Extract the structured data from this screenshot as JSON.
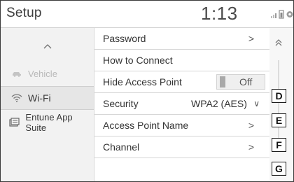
{
  "header": {
    "title": "Setup",
    "clock": "1:13"
  },
  "sidebar": {
    "scroll_up_icon": "chevron-up-icon",
    "items": [
      {
        "label": "Vehicle",
        "icon": "car-icon",
        "state": "dim"
      },
      {
        "label": "Wi-Fi",
        "icon": "wifi-icon",
        "state": "selected"
      },
      {
        "label": "Entune App Suite",
        "icon": "app-suite-icon",
        "state": "normal"
      }
    ]
  },
  "list": {
    "rows": [
      {
        "label": "Password",
        "chevron": ">"
      },
      {
        "label": "How to Connect"
      },
      {
        "label": "Hide Access Point",
        "toggle_value": "Off"
      },
      {
        "label": "Security",
        "value": "WPA2 (AES)",
        "value_chevron": "∨"
      },
      {
        "label": "Access Point Name",
        "chevron": ">"
      },
      {
        "label": "Channel",
        "chevron": ">"
      }
    ]
  },
  "scrollbar": {
    "up_icon": "double-chevron-up-icon"
  },
  "callouts": [
    "D",
    "E",
    "F",
    "G"
  ],
  "colors": {
    "background": "#f7f7f7",
    "list_background": "#ffffff",
    "selected_item": "#e6e6e6",
    "border": "#3a3a3a"
  }
}
